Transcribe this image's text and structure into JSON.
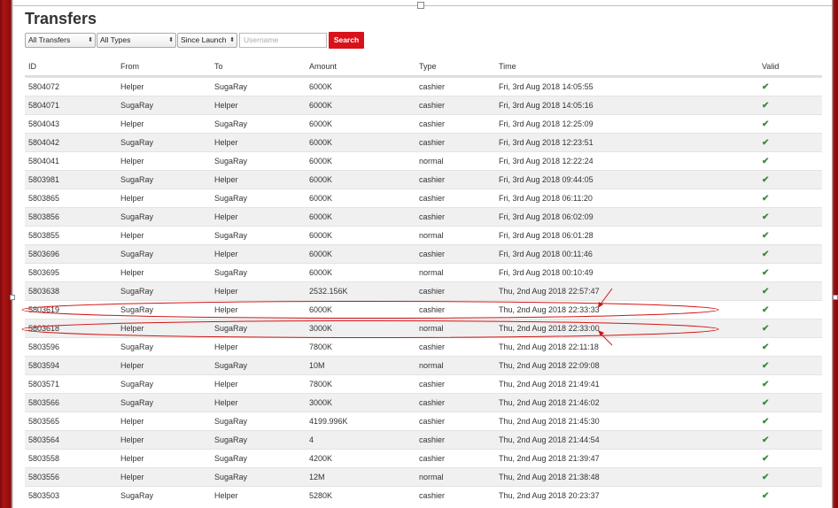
{
  "page": {
    "title": "Transfers"
  },
  "filters": {
    "transfers_select": "All Transfers",
    "types_select": "All Types",
    "period_select": "Since Launch",
    "username_placeholder": "Username",
    "search_label": "Search"
  },
  "table": {
    "headers": [
      "ID",
      "From",
      "To",
      "Amount",
      "Type",
      "Time",
      "Valid"
    ],
    "rows": [
      {
        "id": "5804072",
        "from": "Helper",
        "to": "SugaRay",
        "amount": "6000K",
        "type": "cashier",
        "time": "Fri, 3rd Aug 2018 14:05:55",
        "valid": "✔"
      },
      {
        "id": "5804071",
        "from": "SugaRay",
        "to": "Helper",
        "amount": "6000K",
        "type": "cashier",
        "time": "Fri, 3rd Aug 2018 14:05:16",
        "valid": "✔"
      },
      {
        "id": "5804043",
        "from": "Helper",
        "to": "SugaRay",
        "amount": "6000K",
        "type": "cashier",
        "time": "Fri, 3rd Aug 2018 12:25:09",
        "valid": "✔"
      },
      {
        "id": "5804042",
        "from": "SugaRay",
        "to": "Helper",
        "amount": "6000K",
        "type": "cashier",
        "time": "Fri, 3rd Aug 2018 12:23:51",
        "valid": "✔"
      },
      {
        "id": "5804041",
        "from": "Helper",
        "to": "SugaRay",
        "amount": "6000K",
        "type": "normal",
        "time": "Fri, 3rd Aug 2018 12:22:24",
        "valid": "✔"
      },
      {
        "id": "5803981",
        "from": "SugaRay",
        "to": "Helper",
        "amount": "6000K",
        "type": "cashier",
        "time": "Fri, 3rd Aug 2018 09:44:05",
        "valid": "✔"
      },
      {
        "id": "5803865",
        "from": "Helper",
        "to": "SugaRay",
        "amount": "6000K",
        "type": "cashier",
        "time": "Fri, 3rd Aug 2018 06:11:20",
        "valid": "✔"
      },
      {
        "id": "5803856",
        "from": "SugaRay",
        "to": "Helper",
        "amount": "6000K",
        "type": "cashier",
        "time": "Fri, 3rd Aug 2018 06:02:09",
        "valid": "✔"
      },
      {
        "id": "5803855",
        "from": "Helper",
        "to": "SugaRay",
        "amount": "6000K",
        "type": "normal",
        "time": "Fri, 3rd Aug 2018 06:01:28",
        "valid": "✔"
      },
      {
        "id": "5803696",
        "from": "SugaRay",
        "to": "Helper",
        "amount": "6000K",
        "type": "cashier",
        "time": "Fri, 3rd Aug 2018 00:11:46",
        "valid": "✔"
      },
      {
        "id": "5803695",
        "from": "Helper",
        "to": "SugaRay",
        "amount": "6000K",
        "type": "normal",
        "time": "Fri, 3rd Aug 2018 00:10:49",
        "valid": "✔"
      },
      {
        "id": "5803638",
        "from": "SugaRay",
        "to": "Helper",
        "amount": "2532.156K",
        "type": "cashier",
        "time": "Thu, 2nd Aug 2018 22:57:47",
        "valid": "✔"
      },
      {
        "id": "5803619",
        "from": "SugaRay",
        "to": "Helper",
        "amount": "6000K",
        "type": "cashier",
        "time": "Thu, 2nd Aug 2018 22:33:33",
        "valid": "✔"
      },
      {
        "id": "5803618",
        "from": "Helper",
        "to": "SugaRay",
        "amount": "3000K",
        "type": "normal",
        "time": "Thu, 2nd Aug 2018 22:33:00",
        "valid": "✔"
      },
      {
        "id": "5803596",
        "from": "SugaRay",
        "to": "Helper",
        "amount": "7800K",
        "type": "cashier",
        "time": "Thu, 2nd Aug 2018 22:11:18",
        "valid": "✔"
      },
      {
        "id": "5803594",
        "from": "Helper",
        "to": "SugaRay",
        "amount": "10M",
        "type": "normal",
        "time": "Thu, 2nd Aug 2018 22:09:08",
        "valid": "✔"
      },
      {
        "id": "5803571",
        "from": "SugaRay",
        "to": "Helper",
        "amount": "7800K",
        "type": "cashier",
        "time": "Thu, 2nd Aug 2018 21:49:41",
        "valid": "✔"
      },
      {
        "id": "5803566",
        "from": "SugaRay",
        "to": "Helper",
        "amount": "3000K",
        "type": "cashier",
        "time": "Thu, 2nd Aug 2018 21:46:02",
        "valid": "✔"
      },
      {
        "id": "5803565",
        "from": "Helper",
        "to": "SugaRay",
        "amount": "4199.996K",
        "type": "cashier",
        "time": "Thu, 2nd Aug 2018 21:45:30",
        "valid": "✔"
      },
      {
        "id": "5803564",
        "from": "Helper",
        "to": "SugaRay",
        "amount": "4",
        "type": "cashier",
        "time": "Thu, 2nd Aug 2018 21:44:54",
        "valid": "✔"
      },
      {
        "id": "5803558",
        "from": "Helper",
        "to": "SugaRay",
        "amount": "4200K",
        "type": "cashier",
        "time": "Thu, 2nd Aug 2018 21:39:47",
        "valid": "✔"
      },
      {
        "id": "5803556",
        "from": "Helper",
        "to": "SugaRay",
        "amount": "12M",
        "type": "normal",
        "time": "Thu, 2nd Aug 2018 21:38:48",
        "valid": "✔"
      },
      {
        "id": "5803503",
        "from": "SugaRay",
        "to": "Helper",
        "amount": "5280K",
        "type": "cashier",
        "time": "Thu, 2nd Aug 2018 20:23:37",
        "valid": "✔"
      }
    ]
  },
  "colors": {
    "accent": "#d9111a",
    "check": "#3c8a3c",
    "annotation": "#d21414",
    "frame": "#8c0c0c"
  },
  "icons": {
    "valid": "checkmark-icon",
    "select_arrow": "updown-arrow-icon"
  }
}
